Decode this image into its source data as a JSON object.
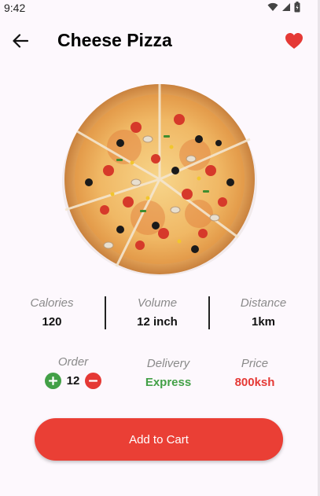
{
  "status_bar": {
    "time": "9:42",
    "icons": [
      "wifi-icon",
      "cellular-signal-icon",
      "battery-icon"
    ]
  },
  "header": {
    "title": "Cheese Pizza",
    "back_icon": "arrow-left-icon",
    "favorite_icon": "heart-icon",
    "favorite_active": true
  },
  "product": {
    "image": "pizza-image"
  },
  "stats": [
    {
      "label": "Calories",
      "value": "120"
    },
    {
      "label": "Volume",
      "value": "12 inch"
    },
    {
      "label": "Distance",
      "value": "1km"
    }
  ],
  "order": {
    "label": "Order",
    "quantity": "12",
    "plus_icon": "plus-icon",
    "minus_icon": "minus-icon"
  },
  "delivery": {
    "label": "Delivery",
    "value": "Express"
  },
  "price": {
    "label": "Price",
    "value": "800ksh"
  },
  "actions": {
    "add_to_cart_label": "Add to Cart"
  },
  "colors": {
    "accent_red": "#ea3f35",
    "green": "#43a047",
    "price_red": "#e53935",
    "background": "#fdf8fd"
  }
}
